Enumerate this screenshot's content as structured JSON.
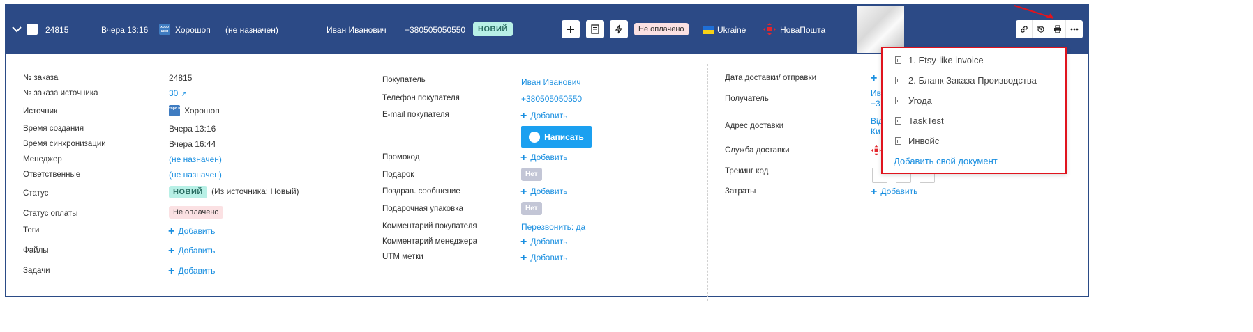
{
  "header": {
    "order_id": "24815",
    "created": "Вчера 13:16",
    "source_name": "Хорошоп",
    "source_logo_text": "хоро шоп",
    "manager": "(не назначен)",
    "customer": "Иван Иванович",
    "phone": "+380505050550",
    "status": "НОВИЙ",
    "payment_status": "Не оплачено",
    "country": "Ukraine",
    "carrier": "НоваПошта",
    "colors": {
      "header_bg": "#2c4a86",
      "status_bg": "#b8f0e6",
      "unpaid_bg": "#fbe1e3",
      "accent": "#1a8fe0",
      "highlight": "#e0141e"
    }
  },
  "col1": {
    "labels": {
      "order_no": "№ заказа",
      "source_order_no": "№ заказа источника",
      "source": "Источник",
      "created": "Время создания",
      "synced": "Время синхронизации",
      "manager": "Менеджер",
      "responsible": "Ответственные",
      "status": "Статус",
      "payment": "Статус оплаты",
      "tags": "Теги",
      "files": "Файлы",
      "tasks": "Задачи"
    },
    "values": {
      "order_no": "24815",
      "source_order_no": "30",
      "source": "Хорошоп",
      "created": "Вчера 13:16",
      "synced": "Вчера 16:44",
      "manager": "(не назначен)",
      "responsible": "(не назначен)",
      "status": "НОВИЙ",
      "status_note": "(Из источника: Новый)",
      "payment": "Не оплачено",
      "tags": "Добавить",
      "files": "Добавить",
      "tasks": "Добавить"
    }
  },
  "col2": {
    "labels": {
      "buyer": "Покупатель",
      "phone": "Телефон покупателя",
      "email": "E-mail покупателя",
      "promo": "Промокод",
      "gift": "Подарок",
      "greeting": "Поздрав. сообщение",
      "wrap": "Подарочная упаковка",
      "buyer_comment": "Комментарий покупателя",
      "manager_comment": "Комментарий менеджера",
      "utm": "UTM метки"
    },
    "values": {
      "buyer": "Иван Иванович",
      "phone": "+380505050550",
      "email": "Добавить",
      "write": "Написать",
      "promo": "Добавить",
      "gift": "Нет",
      "greeting": "Добавить",
      "wrap": "Нет",
      "buyer_comment": "Перезвонить: да",
      "manager_comment": "Добавить",
      "utm": "Добавить"
    }
  },
  "col3": {
    "labels": {
      "delivery_date": "Дата доставки/ отправки",
      "recipient": "Получатель",
      "address": "Адрес доставки",
      "service": "Служба доставки",
      "tracking": "Трекинг код",
      "costs": "Затраты"
    },
    "values": {
      "recipient_1": "Ив",
      "recipient_2": "+3",
      "address_1": "Від",
      "address_2": "Ки",
      "costs": "Добавить"
    }
  },
  "print_menu": {
    "items": [
      "1. Etsy-like invoice",
      "2. Бланк Заказа Производства",
      "Угода",
      "TaskTest",
      "Инвойс"
    ],
    "add_label": "Добавить свой документ"
  },
  "icons": {
    "header_buttons": [
      "plus-icon",
      "document-icon",
      "lightning-icon"
    ],
    "toolbar": [
      "link-icon",
      "history-icon",
      "print-icon",
      "more-icon"
    ]
  }
}
